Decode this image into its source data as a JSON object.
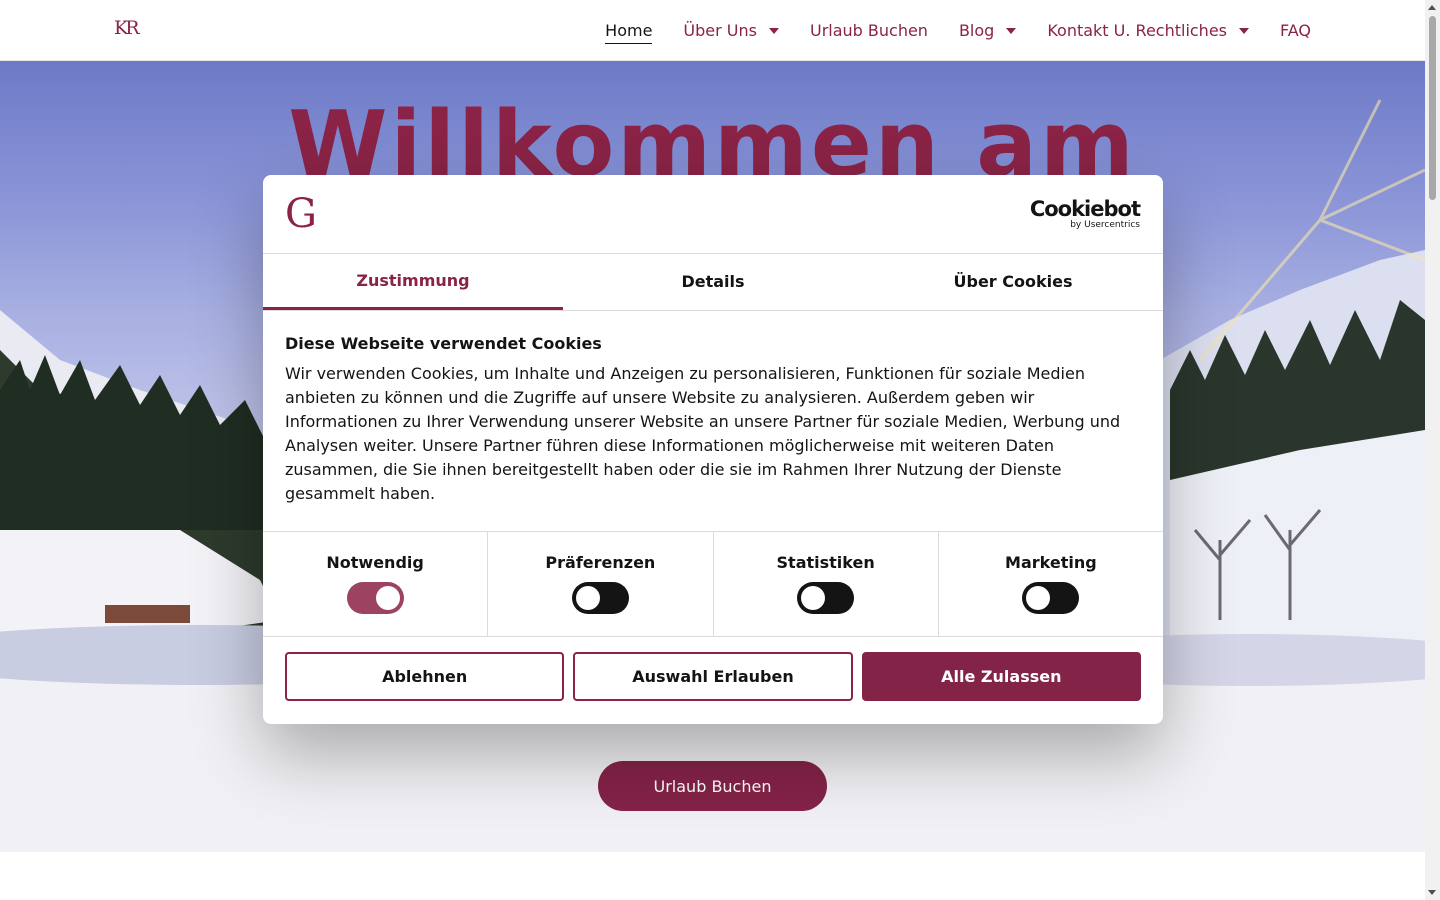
{
  "brand": {
    "logo_text": "KR",
    "accent_color": "#8a2346"
  },
  "nav": {
    "items": [
      {
        "label": "Home",
        "active": true,
        "has_dropdown": false
      },
      {
        "label": "Über Uns",
        "active": false,
        "has_dropdown": true
      },
      {
        "label": "Urlaub Buchen",
        "active": false,
        "has_dropdown": false
      },
      {
        "label": "Blog",
        "active": false,
        "has_dropdown": true
      },
      {
        "label": "Kontakt U. Rechtliches",
        "active": false,
        "has_dropdown": true
      },
      {
        "label": "FAQ",
        "active": false,
        "has_dropdown": false
      }
    ]
  },
  "hero": {
    "title": "Willkommen am",
    "cta_label": "Urlaub Buchen"
  },
  "cookie_dialog": {
    "brand_initial": "G",
    "provider_logo": "Cookiebot",
    "provider_sub": "by Usercentrics",
    "tabs": [
      {
        "label": "Zustimmung",
        "active": true
      },
      {
        "label": "Details",
        "active": false
      },
      {
        "label": "Über Cookies",
        "active": false
      }
    ],
    "title": "Diese Webseite verwendet Cookies",
    "text": "Wir verwenden Cookies, um Inhalte und Anzeigen zu personalisieren, Funktionen für soziale Medien anbieten zu können und die Zugriffe auf unsere Website zu analysieren. Außerdem geben wir Informationen zu Ihrer Verwendung unserer Website an unsere Partner für soziale Medien, Werbung und Analysen weiter. Unsere Partner führen diese Informationen möglicherweise mit weiteren Daten zusammen, die Sie ihnen bereitgestellt haben oder die sie im Rahmen Ihrer Nutzung der Dienste gesammelt haben.",
    "preferences": [
      {
        "label": "Notwendig",
        "enabled": true
      },
      {
        "label": "Präferenzen",
        "enabled": false
      },
      {
        "label": "Statistiken",
        "enabled": false
      },
      {
        "label": "Marketing",
        "enabled": false
      }
    ],
    "buttons": {
      "decline": "Ablehnen",
      "allow_selection": "Auswahl Erlauben",
      "allow_all": "Alle Zulassen"
    }
  }
}
